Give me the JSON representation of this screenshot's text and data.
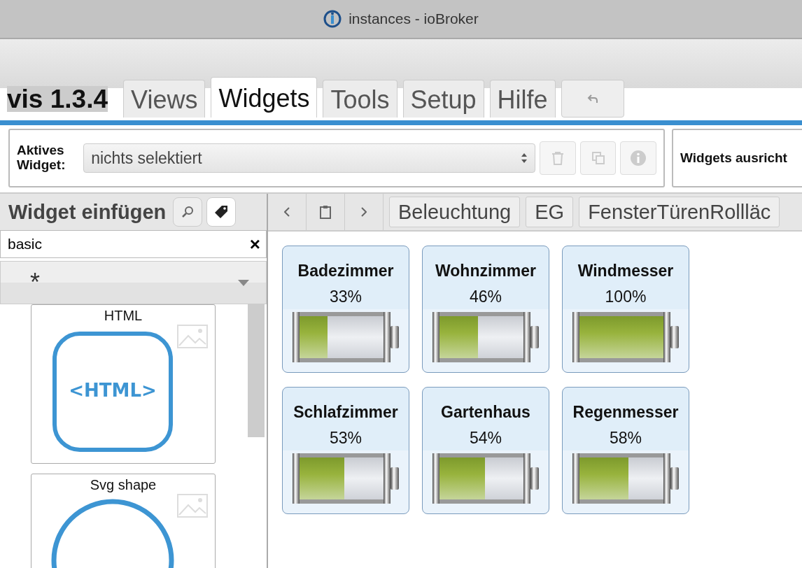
{
  "window": {
    "title": "instances - ioBroker"
  },
  "app": {
    "name": "vis 1.3.4"
  },
  "tabs": [
    {
      "label": "Views",
      "selected": false
    },
    {
      "label": "Widgets",
      "selected": true
    },
    {
      "label": "Tools",
      "selected": false
    },
    {
      "label": "Setup",
      "selected": false
    },
    {
      "label": "Hilfe",
      "selected": false
    }
  ],
  "active_widget": {
    "label": "Aktives Widget:",
    "value": "nichts selektiert"
  },
  "align_panel": {
    "label": "Widgets ausricht"
  },
  "insert_panel": {
    "title": "Widget einfügen",
    "search": {
      "value": "basic",
      "clear": "×"
    },
    "filter": {
      "value": "*"
    },
    "widgets": [
      {
        "name": "HTML",
        "kind": "html",
        "preview": "<HTML>"
      },
      {
        "name": "Svg shape",
        "kind": "circle"
      }
    ]
  },
  "view_tabs": [
    {
      "label": "Beleuchtung"
    },
    {
      "label": "EG"
    },
    {
      "label": "FensterTürenRollläc"
    }
  ],
  "batteries": [
    {
      "name": "Badezimmer",
      "reading": "33%",
      "level": 0.33
    },
    {
      "name": "Wohnzimmer",
      "reading": "46%",
      "level": 0.46
    },
    {
      "name": "Windmesser",
      "reading": "100%",
      "level": 1
    },
    {
      "name": "Schlafzimmer",
      "reading": "53%",
      "level": 0.53
    },
    {
      "name": "Gartenhaus",
      "reading": "54%",
      "level": 0.54
    },
    {
      "name": "Regenmesser",
      "reading": "58%",
      "level": 0.58
    }
  ]
}
